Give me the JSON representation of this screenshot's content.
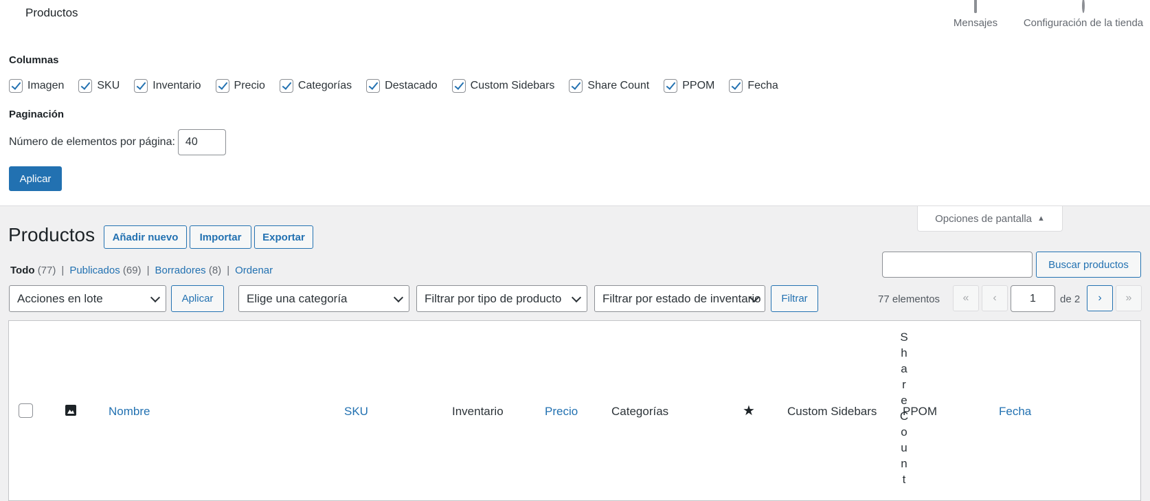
{
  "topbar": {
    "title": "Productos",
    "actions": [
      {
        "label": "Mensajes",
        "icon": "inbox-icon"
      },
      {
        "label": "Configuración de la tienda",
        "icon": "circle-icon"
      }
    ]
  },
  "screen_options": {
    "columns_heading": "Columnas",
    "columns": [
      {
        "label": "Imagen",
        "checked": true
      },
      {
        "label": "SKU",
        "checked": true
      },
      {
        "label": "Inventario",
        "checked": true
      },
      {
        "label": "Precio",
        "checked": true
      },
      {
        "label": "Categorías",
        "checked": true
      },
      {
        "label": "Destacado",
        "checked": true
      },
      {
        "label": "Custom Sidebars",
        "checked": true
      },
      {
        "label": "Share Count",
        "checked": true
      },
      {
        "label": "PPOM",
        "checked": true
      },
      {
        "label": "Fecha",
        "checked": true
      }
    ],
    "pagination_heading": "Paginación",
    "per_page_label": "Número de elementos por página:",
    "per_page_value": "40",
    "apply_label": "Aplicar",
    "tab_label": "Opciones de pantalla"
  },
  "header": {
    "title": "Productos",
    "add_new": "Añadir nuevo",
    "import": "Importar",
    "export": "Exportar"
  },
  "status_links": [
    {
      "label": "Todo",
      "count": "(77)",
      "current": true
    },
    {
      "label": "Publicados",
      "count": "(69)",
      "current": false
    },
    {
      "label": "Borradores",
      "count": "(8)",
      "current": false
    },
    {
      "label": "Ordenar",
      "count": "",
      "current": false
    }
  ],
  "search": {
    "value": "",
    "button": "Buscar productos"
  },
  "filters": {
    "bulk_actions": "Acciones en lote",
    "bulk_apply": "Aplicar",
    "category": "Elige una categoría",
    "product_type": "Filtrar por tipo de producto",
    "stock_status": "Filtrar por estado de inventario",
    "filter_button": "Filtrar"
  },
  "pagination": {
    "items": "77 elementos",
    "first": "«",
    "prev": "‹",
    "current_page": "1",
    "of_label": "de 2",
    "next": "›",
    "last": "»"
  },
  "table": {
    "columns": {
      "name": "Nombre",
      "sku": "SKU",
      "inventory": "Inventario",
      "price": "Precio",
      "categories": "Categorías",
      "featured_icon": "star-icon",
      "custom_sidebars": "Custom Sidebars",
      "share_count": "Share Count",
      "ppom": "PPOM",
      "date": "Fecha"
    }
  },
  "colors": {
    "accent": "#2271b1",
    "text": "#1d2327",
    "muted": "#646970",
    "background": "#f0f0f1"
  }
}
